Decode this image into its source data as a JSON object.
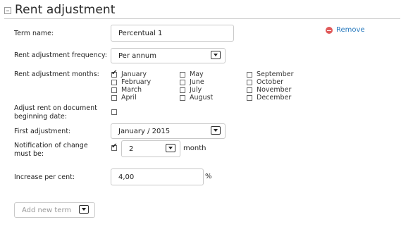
{
  "header": {
    "title": "Rent adjustment"
  },
  "remove": {
    "label": "Remove"
  },
  "fields": {
    "term_name": {
      "label": "Term name:",
      "value": "Percentual 1"
    },
    "frequency": {
      "label": "Rent adjustment frequency:",
      "value": "Per annum"
    },
    "months_label": "Rent adjustment months:",
    "adjust_on_doc": {
      "label": "Adjust rent on document beginning date:",
      "checked": false
    },
    "first_adjustment": {
      "label": "First adjustment:",
      "value": "January / 2015"
    },
    "notification": {
      "label": "Notification of change must be:",
      "checked": true,
      "value": "2",
      "unit": "month"
    },
    "increase": {
      "label": "Increase per cent:",
      "value": "4,00",
      "unit": "%"
    }
  },
  "months": [
    {
      "name": "January",
      "checked": true
    },
    {
      "name": "February",
      "checked": false
    },
    {
      "name": "March",
      "checked": false
    },
    {
      "name": "April",
      "checked": false
    },
    {
      "name": "May",
      "checked": false
    },
    {
      "name": "June",
      "checked": false
    },
    {
      "name": "July",
      "checked": false
    },
    {
      "name": "August",
      "checked": false
    },
    {
      "name": "September",
      "checked": false
    },
    {
      "name": "October",
      "checked": false
    },
    {
      "name": "November",
      "checked": false
    },
    {
      "name": "December",
      "checked": false
    }
  ],
  "add_term": {
    "placeholder": "Add new term"
  },
  "colors": {
    "remove_icon": "#e05a5a",
    "link": "#2a7bbf",
    "border": "#c9c9c9"
  }
}
